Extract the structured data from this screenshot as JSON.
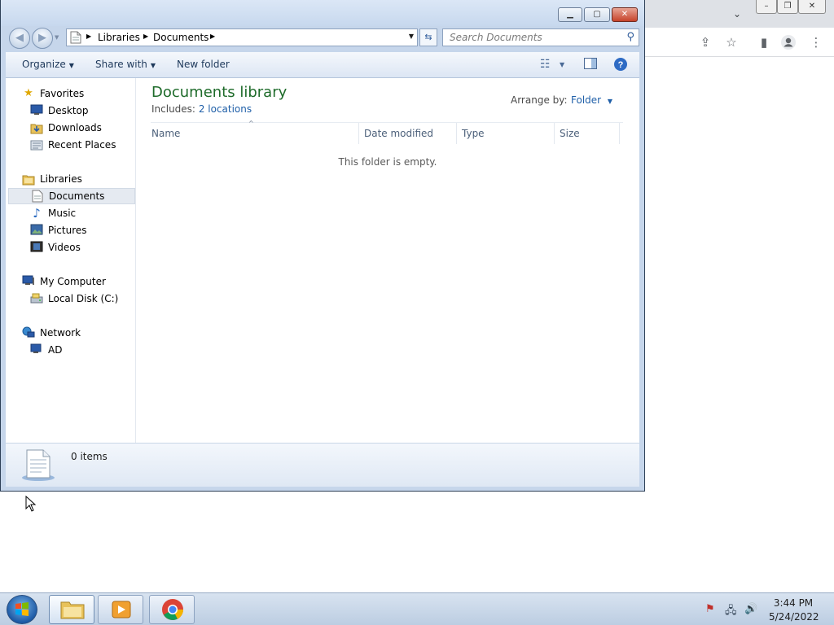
{
  "chrome": {
    "tab_dropdown_icon": "chevron-down-icon",
    "share_icon": "share-icon",
    "bookmark_icon": "star-icon",
    "sidebar_icon": "side-panel-icon",
    "profile_icon": "profile-icon",
    "menu_icon": "kebab-menu-icon"
  },
  "explorer": {
    "breadcrumb": [
      "Libraries",
      "Documents"
    ],
    "search_placeholder": "Search Documents",
    "toolbar": {
      "organize": "Organize",
      "share_with": "Share with",
      "new_folder": "New folder"
    },
    "nav": {
      "favorites": "Favorites",
      "favorites_items": [
        "Desktop",
        "Downloads",
        "Recent Places"
      ],
      "libraries": "Libraries",
      "libraries_items": [
        "Documents",
        "Music",
        "Pictures",
        "Videos"
      ],
      "computer": "My Computer",
      "computer_items": [
        "Local Disk (C:)"
      ],
      "network": "Network",
      "network_items": [
        "AD"
      ]
    },
    "library": {
      "title": "Documents library",
      "includes_label": "Includes:",
      "locations": "2 locations",
      "arrange_label": "Arrange by:",
      "arrange_value": "Folder"
    },
    "columns": [
      "Name",
      "Date modified",
      "Type",
      "Size"
    ],
    "empty_message": "This folder is empty.",
    "status": "0 items"
  },
  "taskbar": {
    "time": "3:44 PM",
    "date": "5/24/2022"
  },
  "colors": {
    "accent_green": "#1e6b2a",
    "link_blue": "#1f5fa8"
  }
}
